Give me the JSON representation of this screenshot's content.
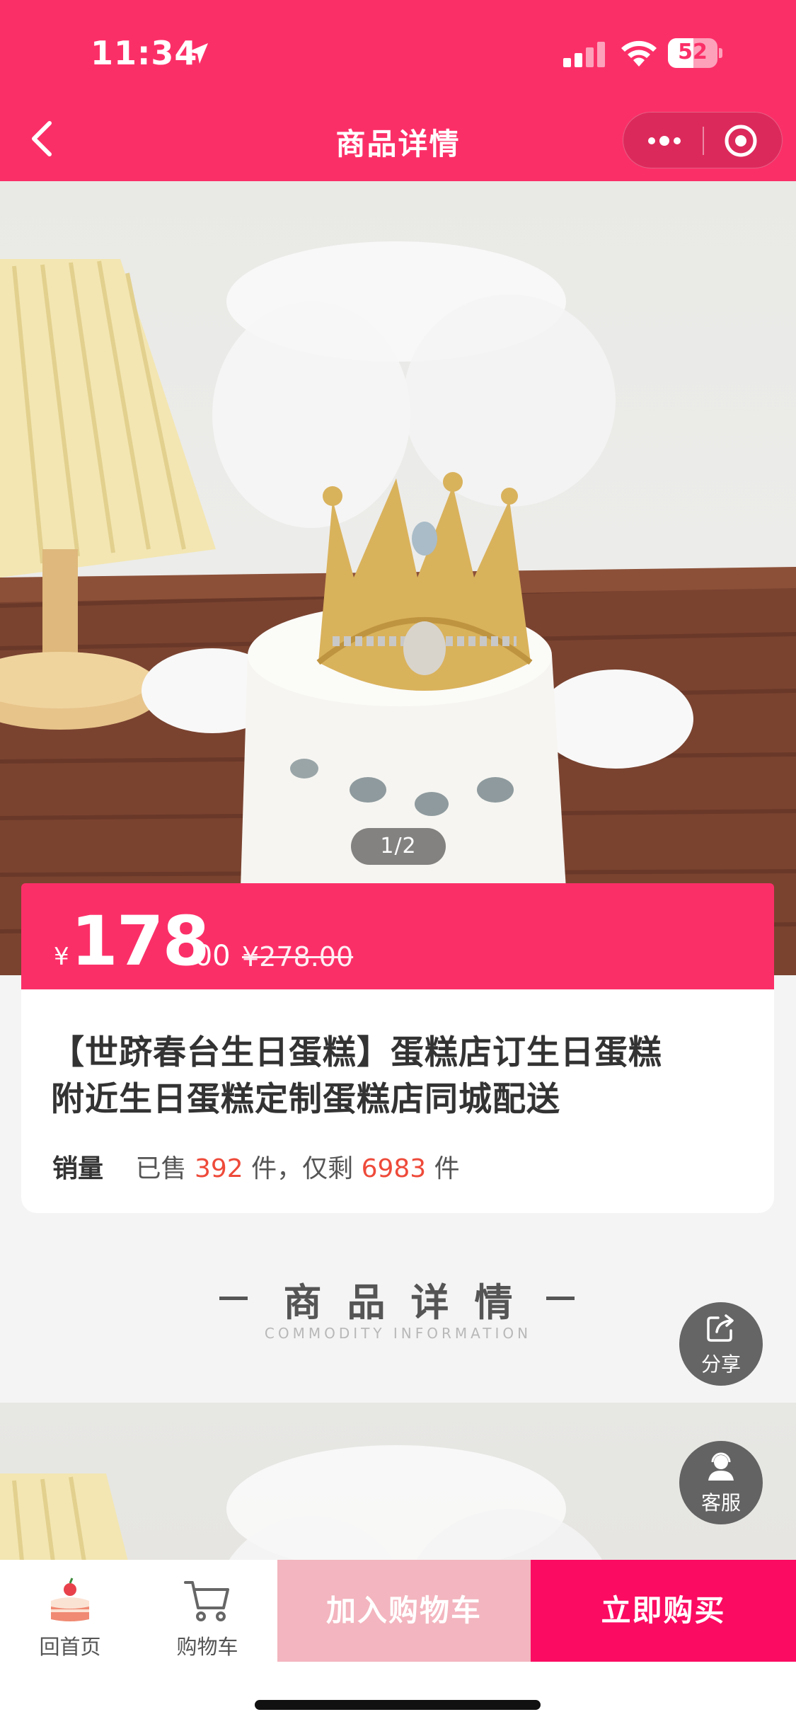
{
  "status_bar": {
    "time": "11:34",
    "battery": "52",
    "battery_level": 0.52
  },
  "nav": {
    "title": "商品详情"
  },
  "gallery": {
    "pager": "1/2"
  },
  "price": {
    "currency": "¥",
    "integer": "178",
    "decimal": ".00",
    "original": "¥278.00"
  },
  "product": {
    "title_line1": "【世跻春台生日蛋糕】蛋糕店订生日蛋糕",
    "title_line2": "附近生日蛋糕定制蛋糕店同城配送",
    "sales_label": "销量",
    "sold_prefix": "已售",
    "sold_count": "392",
    "sold_suffix": "件，仅剩",
    "stock_count": "6983",
    "stock_suffix": "件"
  },
  "section": {
    "title": "商品详情",
    "subtitle": "COMMODITY INFORMATION"
  },
  "floating": {
    "share_label": "分享",
    "service_label": "客服"
  },
  "bottom_bar": {
    "home_label": "回首页",
    "cart_label": "购物车",
    "add_cart_label": "加入购物车",
    "buy_now_label": "立即购买"
  },
  "colors": {
    "brand": "#fb2f68",
    "buy_button": "#fb0b62",
    "add_cart_button": "#f3b5bf",
    "highlight_number": "#ee4a3a"
  }
}
